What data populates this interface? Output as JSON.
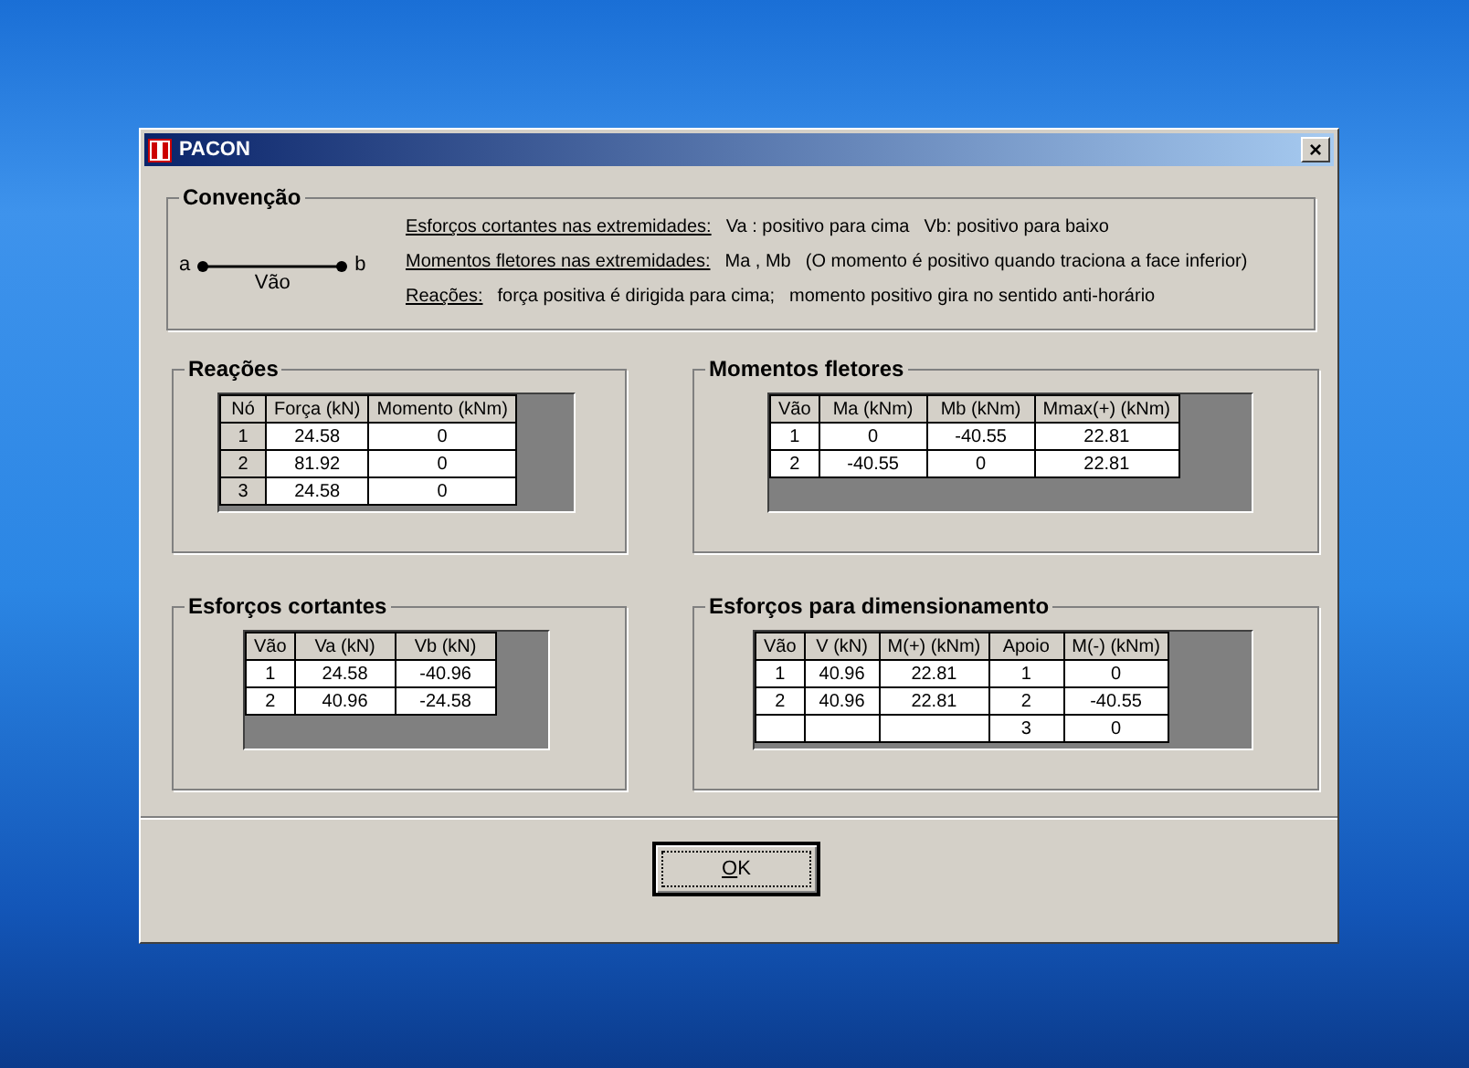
{
  "window": {
    "title": "PACON",
    "close": "×"
  },
  "convention": {
    "title": "Convenção",
    "diagram": {
      "start": "a",
      "end": "b",
      "span": "Vão"
    },
    "lines": [
      {
        "label": "Esforços cortantes nas extremidades:",
        "texts": [
          "Va : positivo para cima",
          "Vb: positivo para baixo"
        ]
      },
      {
        "label": "Momentos fletores nas extremidades:",
        "texts": [
          "Ma , Mb",
          "(O momento é positivo quando traciona a face inferior)"
        ]
      },
      {
        "label": "Reações:",
        "texts": [
          "força positiva é dirigida para cima;",
          "momento positivo gira no sentido anti-horário"
        ]
      }
    ]
  },
  "panels": [
    {
      "title": "Reações",
      "row_header_column": true,
      "columns": [
        "Nó",
        "Força (kN)",
        "Momento (kNm)"
      ],
      "rows": [
        [
          "1",
          "24.58",
          "0"
        ],
        [
          "2",
          "81.92",
          "0"
        ],
        [
          "3",
          "24.58",
          "0"
        ]
      ]
    },
    {
      "title": "Momentos fletores",
      "row_header_column": false,
      "columns": [
        "Vão",
        "Ma (kNm)",
        "Mb (kNm)",
        "Mmax(+) (kNm)"
      ],
      "rows": [
        [
          "1",
          "0",
          "-40.55",
          "22.81"
        ],
        [
          "2",
          "-40.55",
          "0",
          "22.81"
        ]
      ]
    },
    {
      "title": "Esforços cortantes",
      "row_header_column": false,
      "columns": [
        "Vão",
        "Va (kN)",
        "Vb (kN)"
      ],
      "rows": [
        [
          "1",
          "24.58",
          "-40.96"
        ],
        [
          "2",
          "40.96",
          "-24.58"
        ]
      ]
    },
    {
      "title": "Esforços para dimensionamento",
      "row_header_column": false,
      "columns": [
        "Vão",
        "V (kN)",
        "M(+) (kNm)",
        "Apoio",
        "M(-) (kNm)"
      ],
      "rows": [
        [
          "1",
          "40.96",
          "22.81",
          "1",
          "0"
        ],
        [
          "2",
          "40.96",
          "22.81",
          "2",
          "-40.55"
        ],
        [
          "",
          "",
          "",
          "3",
          "0"
        ]
      ]
    }
  ],
  "buttons": [
    {
      "label": "OK",
      "default": true
    }
  ]
}
